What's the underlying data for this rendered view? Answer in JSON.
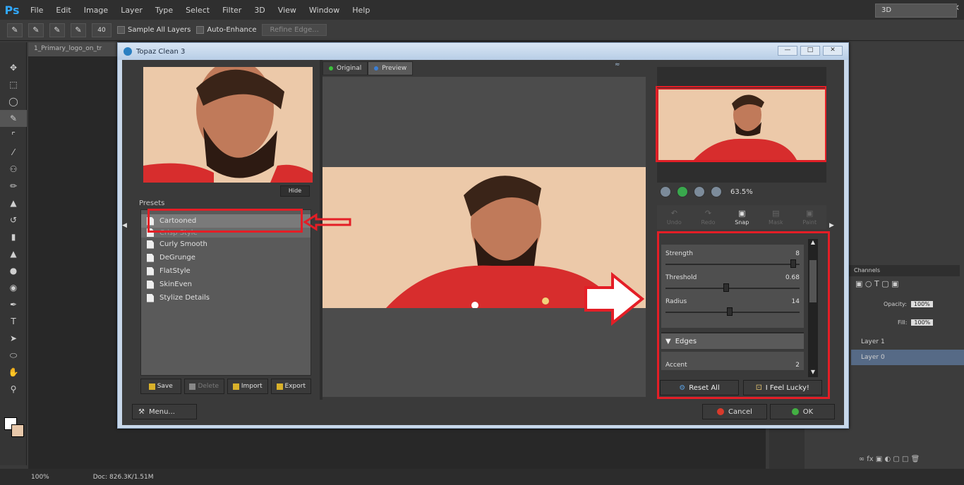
{
  "ps": {
    "logo": "Ps",
    "menu": [
      "File",
      "Edit",
      "Image",
      "Layer",
      "Type",
      "Select",
      "Filter",
      "3D",
      "View",
      "Window",
      "Help"
    ],
    "options": {
      "sample_all_layers": "Sample All Layers",
      "auto_enhance": "Auto-Enhance",
      "refine_edge": "Refine Edge...",
      "brush_size": "40"
    },
    "workspace": "3D",
    "doc_tab": "1_Primary_logo_on_tr",
    "panel": {
      "channels_tab": "Channels",
      "opacity_label": "Opacity:",
      "opacity_value": "100%",
      "fill_label": "Fill:",
      "fill_value": "100%",
      "layers": [
        "Layer 1",
        "Layer 0"
      ]
    },
    "status": {
      "zoom": "100%",
      "doc": "Doc: 826.3K/1.51M"
    }
  },
  "topaz": {
    "title": "Topaz Clean 3",
    "hide_btn": "Hide",
    "presets_label": "Presets",
    "presets": [
      "Cartooned",
      "Crisp Style",
      "Curly Smooth",
      "DeGrunge",
      "FlatStyle",
      "SkinEven",
      "Stylize Details"
    ],
    "preset_actions": [
      "Save",
      "Delete",
      "Import",
      "Export"
    ],
    "menu_btn": "Menu...",
    "tabs": {
      "original": "Original",
      "preview": "Preview"
    },
    "zoom_pct": "63.5%",
    "tools": [
      "Undo",
      "Redo",
      "Snap",
      "Mask",
      "Paint"
    ],
    "params": [
      {
        "label": "Strength",
        "value": "8",
        "fraction": 0.95
      },
      {
        "label": "Threshold",
        "value": "0.68",
        "fraction": 0.45
      },
      {
        "label": "Radius",
        "value": "14",
        "fraction": 0.48
      }
    ],
    "edges_label": "Edges",
    "accent_label": "Accent",
    "accent_value": "2",
    "reset_btn": "Reset All",
    "lucky_btn": "I Feel Lucky!",
    "cancel_btn": "Cancel",
    "ok_btn": "OK"
  },
  "colors": {
    "annotation": "#e41e26",
    "skin_bg": "#ecc9a9",
    "jersey": "#d72d2d"
  }
}
